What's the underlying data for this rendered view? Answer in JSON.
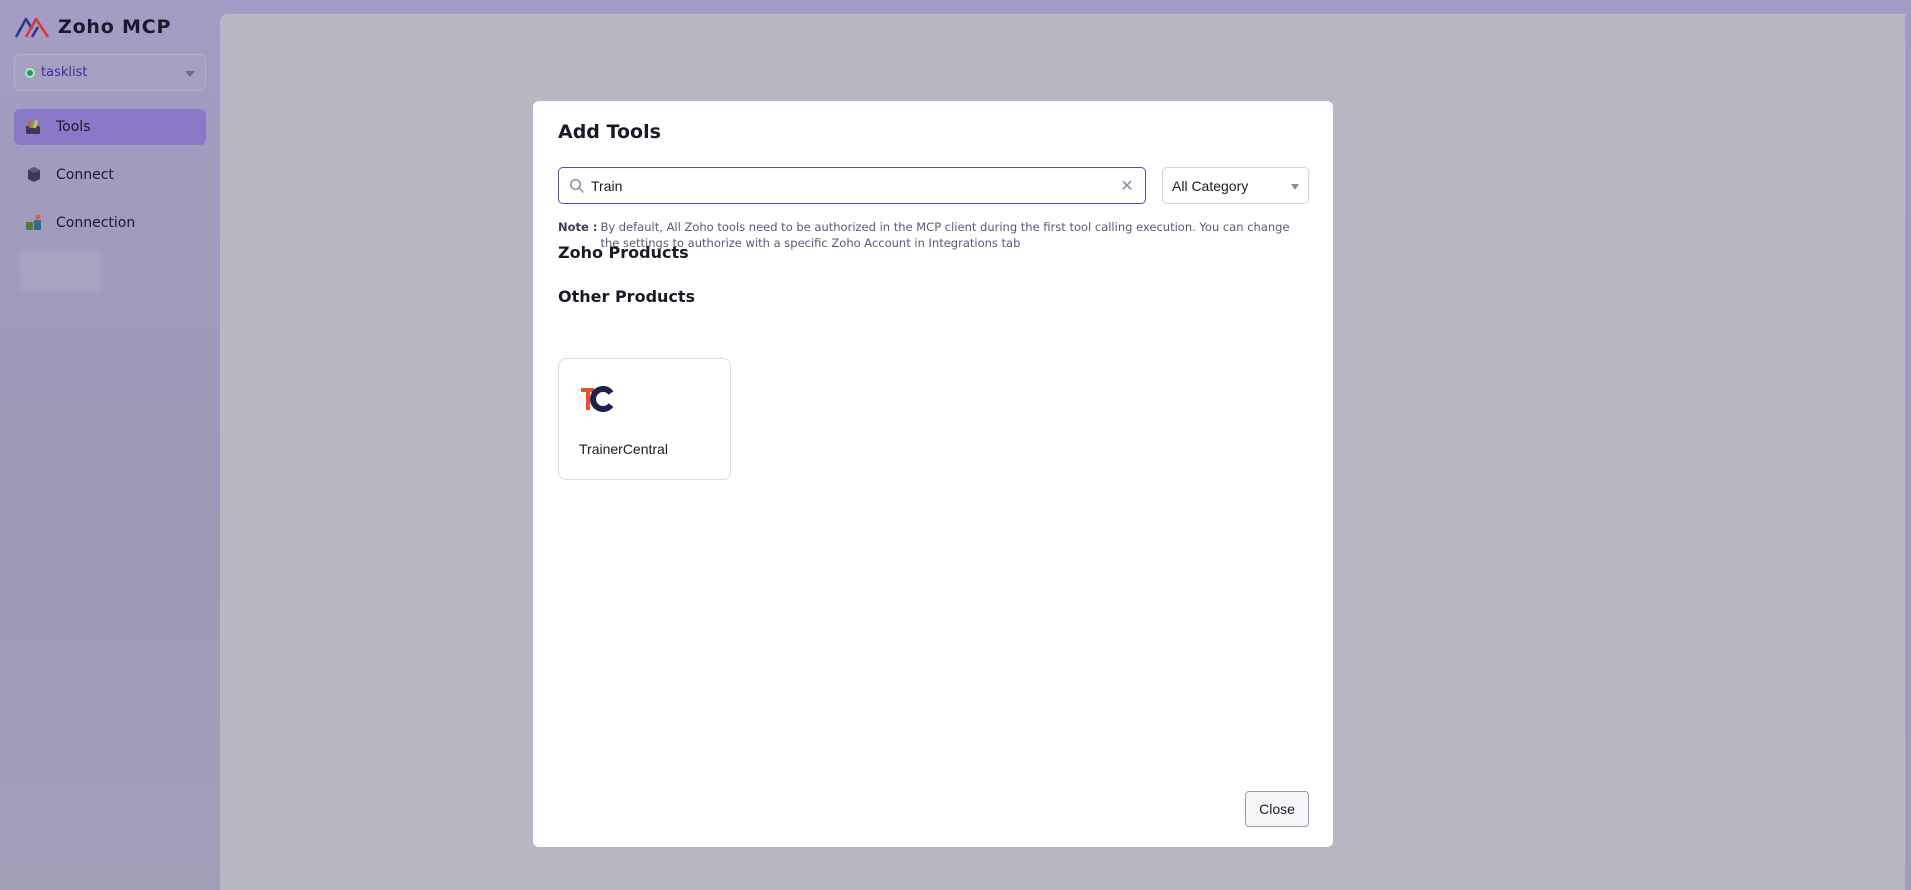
{
  "app": {
    "brand": "Zoho MCP"
  },
  "project": {
    "name": "tasklist",
    "status_color": "#1f9c56"
  },
  "nav": {
    "items": [
      {
        "label": "Tools",
        "icon": "tools-icon",
        "active": true
      },
      {
        "label": "Connect",
        "icon": "connect-icon",
        "active": false
      },
      {
        "label": "Connection",
        "icon": "connection-icon",
        "active": false
      }
    ]
  },
  "modal": {
    "title": "Add Tools",
    "search": {
      "value": "Train"
    },
    "category": {
      "selected": "All Category"
    },
    "note_label": "Note :",
    "note_text": "By default, All Zoho tools need to be authorized in the MCP client during the first tool calling execution. You can change the settings to authorize with a specific Zoho Account in Integrations tab",
    "sections": {
      "zoho_products": "Zoho Products",
      "other_products": "Other Products"
    },
    "products": [
      {
        "name": "TrainerCentral",
        "icon": "trainercentral-logo"
      }
    ],
    "close_label": "Close"
  },
  "colors": {
    "accent": "#5b4db0",
    "active_nav": "#8a78c9",
    "overlay_bg": "#b6b7c1"
  }
}
